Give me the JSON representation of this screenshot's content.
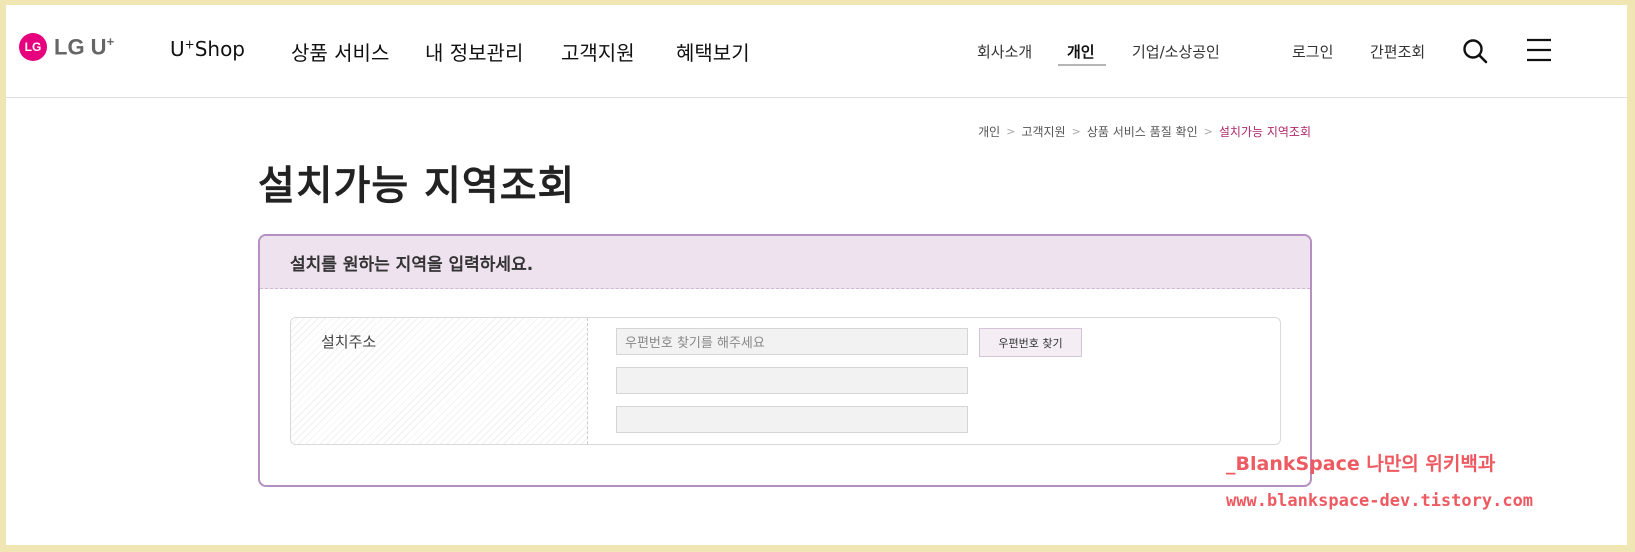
{
  "header": {
    "logo_text": "LG U",
    "logo_sup": "+",
    "logo_mark": "LG",
    "nav": [
      {
        "label": "U",
        "sup": "+",
        "rest": "Shop"
      },
      {
        "label": "상품 서비스"
      },
      {
        "label": "내 정보관리"
      },
      {
        "label": "고객지원"
      },
      {
        "label": "혜택보기"
      }
    ],
    "util": [
      "회사소개",
      "개인",
      "기업/소상공인",
      "로그인",
      "간편조회"
    ],
    "active_util": "개인",
    "icons": [
      "search-icon",
      "menu-icon"
    ]
  },
  "breadcrumb": [
    "개인",
    "고객지원",
    "상품 서비스 품질 확인",
    "설치가능 지역조회"
  ],
  "page_title": "설치가능 지역조회",
  "panel": {
    "heading": "설치를 원하는 지역을 입력하세요.",
    "field_label": "설치주소",
    "zip_placeholder": "우편번호 찾기를 해주세요",
    "zip_button": "우편번호 찾기",
    "address1_value": "",
    "address2_value": ""
  },
  "watermark": {
    "line1": "_BlankSpace 나만의 위키백과",
    "line2": "www.blankspace-dev.tistory.com"
  },
  "colors": {
    "accent": "#b0276b",
    "panel_border": "#b58fbf",
    "panel_head_bg": "#efe2ef",
    "watermark": "#ee5a61",
    "outer_bg": "#efe6b4"
  }
}
